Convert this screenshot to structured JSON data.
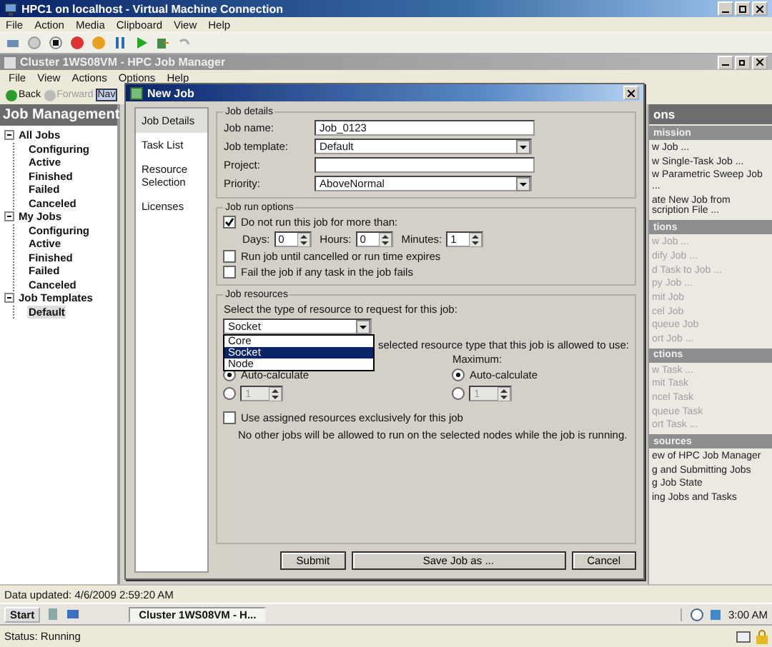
{
  "vm_window": {
    "title": "HPC1 on localhost - Virtual Machine Connection",
    "menu": [
      "File",
      "Action",
      "Media",
      "Clipboard",
      "View",
      "Help"
    ]
  },
  "job_manager": {
    "title": "Cluster 1WS08VM - HPC Job Manager",
    "menu": [
      "File",
      "View",
      "Actions",
      "Options",
      "Help"
    ],
    "toolbar": [
      {
        "label": "Back",
        "disabled": false
      },
      {
        "label": "Forward",
        "disabled": true
      },
      {
        "label": "Nav",
        "disabled": false
      }
    ],
    "navigation": {
      "title": "Job Management",
      "tree": [
        {
          "label": "All Jobs",
          "expanded": true,
          "selected": false,
          "children": [
            {
              "label": "Configuring",
              "selected": false
            },
            {
              "label": "Active",
              "selected": false
            },
            {
              "label": "Finished",
              "selected": false
            },
            {
              "label": "Failed",
              "selected": false
            },
            {
              "label": "Canceled",
              "selected": false
            }
          ]
        },
        {
          "label": "My Jobs",
          "expanded": true,
          "selected": false,
          "children": [
            {
              "label": "Configuring",
              "selected": false
            },
            {
              "label": "Active",
              "selected": false
            },
            {
              "label": "Finished",
              "selected": false
            },
            {
              "label": "Failed",
              "selected": false
            },
            {
              "label": "Canceled",
              "selected": false
            }
          ]
        },
        {
          "label": "Job Templates",
          "expanded": true,
          "selected": false,
          "children": [
            {
              "label": "Default",
              "selected": true
            }
          ]
        }
      ]
    },
    "actions_pane": {
      "title": "ons",
      "sections": [
        {
          "title": "mission",
          "items": [
            {
              "label": "w Job ...",
              "disabled": false
            },
            {
              "label": "w Single-Task Job ...",
              "disabled": false
            },
            {
              "label": "w Parametric Sweep Job ...",
              "disabled": false
            },
            {
              "label": "ate New Job from scription File ...",
              "disabled": false
            }
          ]
        },
        {
          "title": "tions",
          "items": [
            {
              "label": "w Job ...",
              "disabled": true
            },
            {
              "label": "dify Job ...",
              "disabled": true
            },
            {
              "label": "d Task to Job ...",
              "disabled": true
            },
            {
              "label": "py Job ...",
              "disabled": true
            },
            {
              "label": "mit Job",
              "disabled": true
            },
            {
              "label": "cel Job",
              "disabled": true
            },
            {
              "label": "queue Job",
              "disabled": true
            },
            {
              "label": "ort Job ...",
              "disabled": true
            }
          ]
        },
        {
          "title": "ctions",
          "items": [
            {
              "label": "w Task ...",
              "disabled": true
            },
            {
              "label": "mit Task",
              "disabled": true
            },
            {
              "label": "ncel Task",
              "disabled": true
            },
            {
              "label": "queue Task",
              "disabled": true
            },
            {
              "label": "ort Task ...",
              "disabled": true
            }
          ]
        },
        {
          "title": "sources",
          "items": [
            {
              "label": "ew of HPC Job Manager",
              "disabled": false
            },
            {
              "label": "g and Submitting Jobs",
              "disabled": false
            },
            {
              "label": "g Job State",
              "disabled": false
            },
            {
              "label": "ing Jobs and Tasks",
              "disabled": false
            }
          ]
        }
      ]
    },
    "data_status": "Data updated: 4/6/2009 2:59:20 AM"
  },
  "dialog": {
    "title": "New Job",
    "pages": [
      {
        "label": "Job Details",
        "selected": true
      },
      {
        "label": "Task List",
        "selected": false
      },
      {
        "label": "Resource Selection",
        "selected": false
      },
      {
        "label": "Licenses",
        "selected": false
      }
    ],
    "job_details": {
      "title": "Job details",
      "fields": [
        {
          "label": "Job name:",
          "kind": "text",
          "value": "Job_0123"
        },
        {
          "label": "Job template:",
          "kind": "combo",
          "value": "Default"
        },
        {
          "label": "Project:",
          "kind": "text"
        },
        {
          "label": "Priority:",
          "kind": "combo",
          "value": "AboveNormal"
        }
      ]
    },
    "run_options": {
      "title": "Job run options",
      "limit": {
        "label": "Do not run this job for more than:",
        "checked": true
      },
      "spins": [
        {
          "label": "Days:",
          "value": "0"
        },
        {
          "label": "Hours:",
          "value": "0"
        },
        {
          "label": "Minutes:",
          "value": "1"
        }
      ],
      "checks": [
        {
          "label": "Run job until cancelled or run time expires",
          "checked": false
        },
        {
          "label": "Fail the job if any task in the job fails",
          "checked": false
        }
      ]
    },
    "resources": {
      "title": "Job resources",
      "prompt": "Select the type of resource to request for this job:",
      "type_value": "Socket",
      "open": true,
      "options": [
        {
          "label": "Core",
          "selected": false
        },
        {
          "label": "Socket",
          "selected": true
        },
        {
          "label": "Node",
          "selected": false
        }
      ],
      "range_text": "selected resource type that this job is allowed to use:",
      "columns": [
        {
          "choices": [
            {
              "kind": "auto",
              "label": "Auto-calculate",
              "selected": true
            },
            {
              "kind": "spin",
              "value": "1",
              "selected": false
            }
          ]
        },
        {
          "label": "Maximum:",
          "choices": [
            {
              "kind": "auto",
              "label": "Auto-calculate",
              "selected": true
            },
            {
              "kind": "spin",
              "value": "1",
              "selected": false
            }
          ]
        }
      ],
      "exclusive": {
        "label": "Use assigned resources exclusively for this job",
        "checked": false
      },
      "note": "No other jobs will be allowed to run on the selected nodes while the job is running."
    },
    "buttons": [
      "Submit",
      "Save Job as ...",
      "Cancel"
    ]
  },
  "taskbar": {
    "start": "Start",
    "task": "Cluster 1WS08VM - H...",
    "clock": "3:00 AM"
  },
  "status_bar": "Status: Running"
}
